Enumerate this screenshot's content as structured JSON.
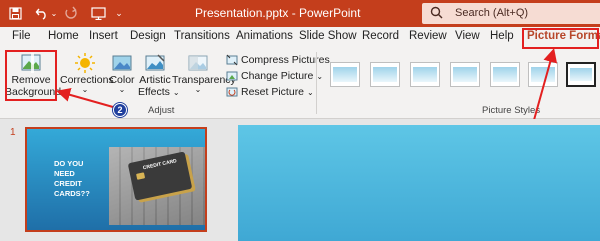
{
  "titlebar": {
    "title": "Presentation.pptx - PowerPoint",
    "search_placeholder": "Search (Alt+Q)",
    "background_color": "#c43e1c"
  },
  "tabs": [
    {
      "label": "File"
    },
    {
      "label": "Home"
    },
    {
      "label": "Insert"
    },
    {
      "label": "Design"
    },
    {
      "label": "Transitions"
    },
    {
      "label": "Animations"
    },
    {
      "label": "Slide Show"
    },
    {
      "label": "Record"
    },
    {
      "label": "Review"
    },
    {
      "label": "View"
    },
    {
      "label": "Help"
    },
    {
      "label": "Picture Format",
      "active": true
    }
  ],
  "ribbon": {
    "remove_bg_line1": "Remove",
    "remove_bg_line2": "Background",
    "corrections": "Corrections",
    "color": "Color",
    "artistic_line1": "Artistic",
    "artistic_line2": "Effects",
    "transparency": "Transparency",
    "compress": "Compress Pictures",
    "change": "Change Picture",
    "reset": "Reset Picture",
    "adjust_group": "Adjust",
    "styles_group": "Picture Styles"
  },
  "annotations": {
    "badge1": "1",
    "badge2": "2",
    "highlight_color": "#e32020",
    "badge_color": "#1f3f9e"
  },
  "slides": {
    "number": "1",
    "thumb_text": [
      "DO YOU",
      "NEED",
      "CREDIT",
      "CARDS??"
    ],
    "card_text": "CREDIT CARD"
  }
}
